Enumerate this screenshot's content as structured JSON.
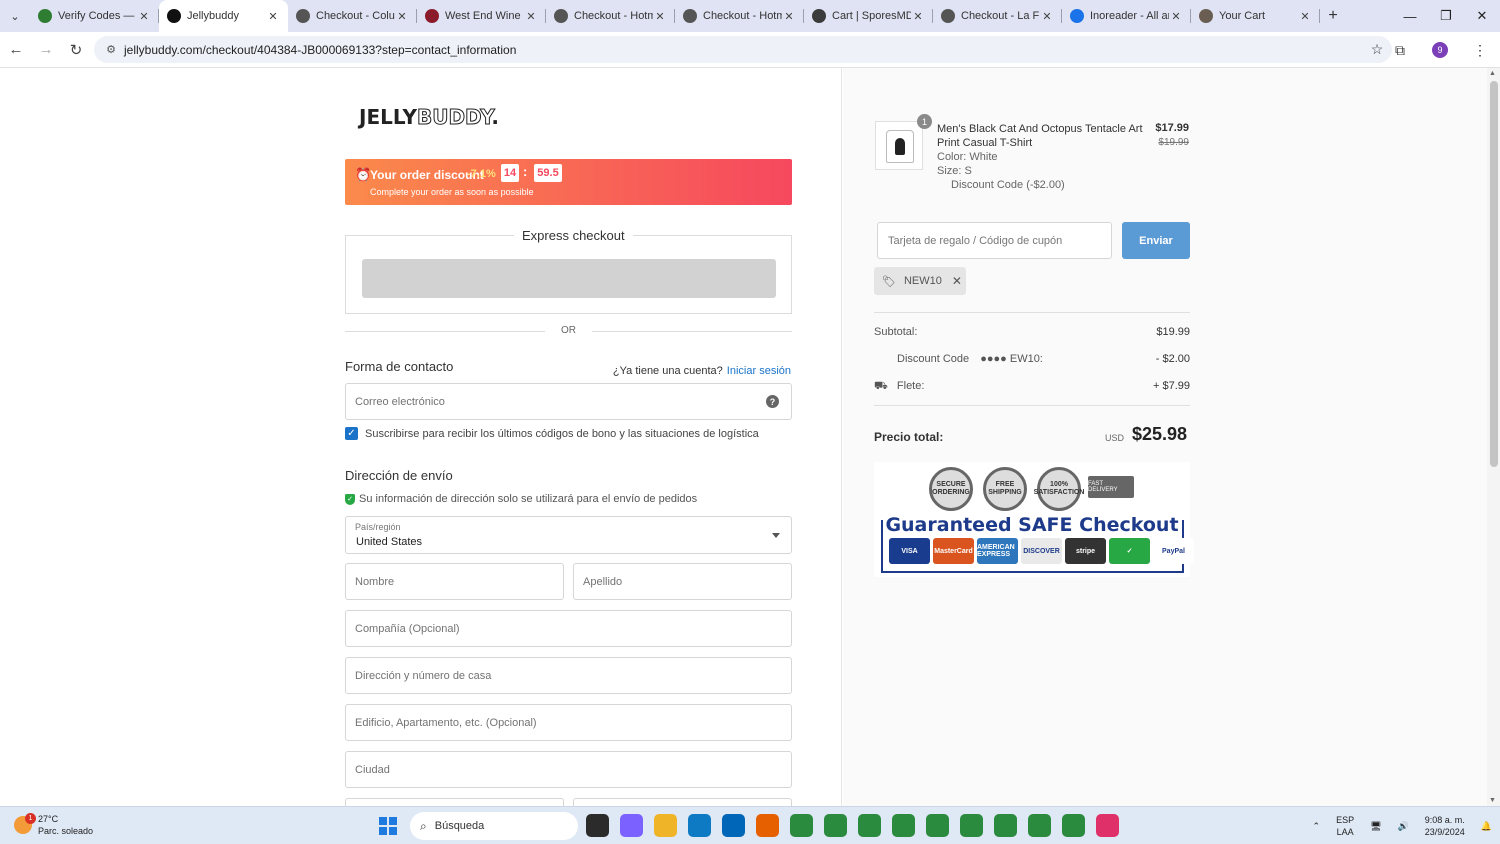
{
  "browser": {
    "tabs": [
      {
        "title": "Verify Codes — Si",
        "icon_color": "#2e7d32",
        "active": false
      },
      {
        "title": "Jellybuddy",
        "icon_color": "#111111",
        "active": true
      },
      {
        "title": "Checkout - Colug",
        "icon_color": "#555555",
        "active": false
      },
      {
        "title": "West End Wine &",
        "icon_color": "#8b1a2b",
        "active": false
      },
      {
        "title": "Checkout - Hotm",
        "icon_color": "#555555",
        "active": false
      },
      {
        "title": "Checkout - Hotm",
        "icon_color": "#555555",
        "active": false
      },
      {
        "title": "Cart | SporesMD",
        "icon_color": "#3b3b3b",
        "active": false
      },
      {
        "title": "Checkout - La Flo",
        "icon_color": "#555555",
        "active": false
      },
      {
        "title": "Inoreader - All ar",
        "icon_color": "#1a73e8",
        "active": false
      },
      {
        "title": "Your Cart",
        "icon_color": "#6a5d52",
        "active": false
      }
    ],
    "url": "jellybuddy.com/checkout/404384-JB000069133?step=contact_information",
    "profile_initial": "9"
  },
  "checkout": {
    "logo": {
      "part1": "JELLY",
      "part2": "BUDDY",
      "dot": "."
    },
    "discount": {
      "title": "Your order discount",
      "percent": "-7.1%",
      "timer_min": "14",
      "timer_sep": ":",
      "timer_sec": "59.5",
      "subtitle": "Complete your order as soon as possible"
    },
    "express_title": "Express checkout",
    "or_label": "OR",
    "contact": {
      "title": "Forma de contacto",
      "account_question": "¿Ya tiene una cuenta?",
      "login_link": "Iniciar sesión",
      "email_placeholder": "Correo electrónico",
      "subscribe_label": "Suscribirse para recibir los últimos códigos de bono y las situaciones de logística",
      "subscribe_checked": true
    },
    "shipping": {
      "title": "Dirección de envío",
      "note": "Su información de dirección solo se utilizará para el envío de pedidos",
      "country_label": "País/región",
      "country_value": "United States",
      "first_name": "Nombre",
      "last_name": "Apellido",
      "company": "Compañía (Opcional)",
      "address": "Dirección y número de casa",
      "apartment": "Edificio, Apartamento, etc. (Opcional)",
      "city": "Ciudad"
    }
  },
  "summary": {
    "product": {
      "quantity": "1",
      "name": "Men's Black Cat And Octopus Tentacle Art Print Casual T-Shirt",
      "color": "Color: White",
      "size": "Size: S",
      "discount_code": "Discount Code (-$2.00)",
      "price": "$17.99",
      "original_price": "$19.99"
    },
    "coupon_placeholder": "Tarjeta de regalo / Código de cupón",
    "coupon_button": "Enviar",
    "applied_code": "NEW10",
    "subtotal_label": "Subtotal:",
    "subtotal_value": "$19.99",
    "discount_label": "Discount Code",
    "discount_code_masked": "●●●● EW10:",
    "discount_value": "- $2.00",
    "shipping_label": "Flete:",
    "shipping_value": "+ $7.99",
    "total_label": "Precio total:",
    "total_currency": "USD",
    "total_value": "$25.98",
    "badges": {
      "seal1": "SECURE ORDERING",
      "seal2": "FREE SHIPPING",
      "seal3": "100% SATISFACTION",
      "truck": "FAST DELIVERY",
      "safe_title": "Guaranteed SAFE Checkout",
      "payments": [
        {
          "name": "VISA",
          "color": "#1a3c8f"
        },
        {
          "name": "MasterCard",
          "color": "#d9541e"
        },
        {
          "name": "AMERICAN EXPRESS",
          "color": "#2e77bc"
        },
        {
          "name": "DISCOVER",
          "color": "#e9e9e9"
        },
        {
          "name": "stripe",
          "color": "#333333"
        },
        {
          "name": "✓",
          "color": "#27a844"
        },
        {
          "name": "PayPal",
          "color": "#ffffff"
        }
      ]
    }
  },
  "taskbar": {
    "weather_temp": "27°C",
    "weather_desc": "Parc. soleado",
    "weather_badge": "1",
    "search": "Búsqueda",
    "lang1": "ESP",
    "lang2": "LAA",
    "time": "9:08 a. m.",
    "date": "23/9/2024",
    "apps": [
      "#2b2b2b",
      "#7b61ff",
      "#f0b429",
      "#0e7ac4",
      "#0067b8",
      "#e66000",
      "#2a8a3e",
      "#2a8a3e",
      "#2a8a3e",
      "#2a8a3e",
      "#2a8a3e",
      "#2a8a3e",
      "#2a8a3e",
      "#2a8a3e",
      "#2a8a3e",
      "#e0306a"
    ]
  }
}
